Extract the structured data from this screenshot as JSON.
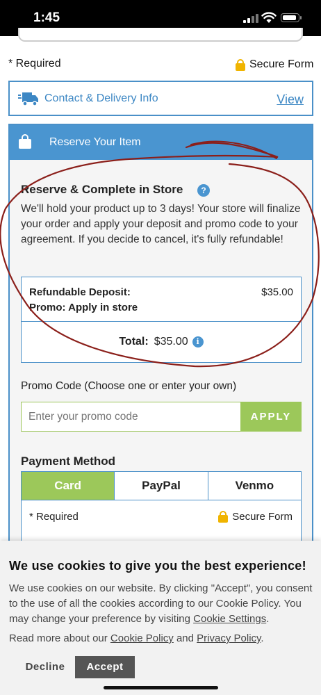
{
  "status_bar": {
    "time": "1:45"
  },
  "form_header": {
    "required": "* Required",
    "secure": "Secure Form"
  },
  "contact": {
    "label": "Contact & Delivery Info",
    "view": "View"
  },
  "reserve": {
    "header": "Reserve Your Item",
    "title": "Reserve & Complete in Store",
    "help_glyph": "?",
    "description": "We'll hold your product up to 3 days! Your store will finalize your order and apply your deposit and promo code to your agreement. If you decide to cancel, it's fully refundable!",
    "deposit_label": "Refundable Deposit:",
    "deposit_value": "$35.00",
    "promo_label": "Promo: Apply in store",
    "total_label": "Total:",
    "total_value": "$35.00",
    "info_glyph": "i"
  },
  "promo": {
    "label": "Promo Code (Choose one or enter your own)",
    "placeholder": "Enter your promo code",
    "apply": "APPLY"
  },
  "payment": {
    "title": "Payment Method",
    "tabs": [
      {
        "label": "Card",
        "active": true
      },
      {
        "label": "PayPal",
        "active": false
      },
      {
        "label": "Venmo",
        "active": false
      }
    ],
    "required": "* Required",
    "secure": "Secure Form"
  },
  "cookie": {
    "title": "We use cookies to give you the best experience!",
    "text_before": "We use cookies on our website. By clicking \"Accept\", you consent to the use of all the cookies according to our Cookie Policy. You may change your preference by visiting ",
    "settings_link": "Cookie Settings",
    "text_after": ".",
    "more_before": "Read more about our ",
    "policy_link": "Cookie Policy",
    "more_and": " and ",
    "privacy_link": "Privacy Policy",
    "more_after": ".",
    "decline": "Decline",
    "accept": "Accept"
  },
  "colors": {
    "accent_blue": "#4a95d0",
    "accent_green": "#9cc85a",
    "lock_yellow": "#f0b400",
    "annotation_red": "#8b1f1a"
  }
}
